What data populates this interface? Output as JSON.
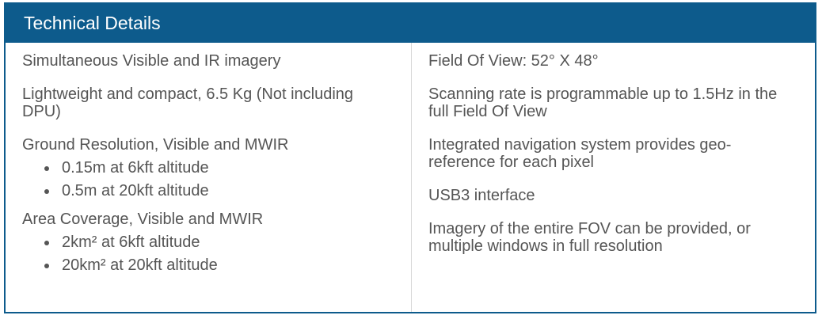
{
  "panel": {
    "title": "Technical Details"
  },
  "left": {
    "items": [
      {
        "text": "Simultaneous Visible and IR imagery"
      },
      {
        "text": "Lightweight and compact, 6.5 Kg (Not including DPU)"
      },
      {
        "text": "Ground Resolution, Visible and MWIR",
        "bullets": [
          "0.15m at 6kft altitude",
          "0.5m at 20kft altitude"
        ]
      },
      {
        "text": "Area Coverage, Visible and MWIR",
        "bullets": [
          "2km² at 6kft altitude",
          "20km² at 20kft altitude"
        ]
      }
    ]
  },
  "right": {
    "items": [
      {
        "text": "Field Of View: 52° X 48°"
      },
      {
        "text": "Scanning rate is programmable up to 1.5Hz in the full Field Of View"
      },
      {
        "text": "Integrated navigation system provides geo-reference for each pixel"
      },
      {
        "text": "USB3 interface"
      },
      {
        "text": "Imagery of the entire FOV can be provided, or multiple windows in full resolution"
      }
    ]
  },
  "colors": {
    "header_bg": "#0d5b8c",
    "header_text": "#ffffff",
    "body_text": "#555555",
    "divider": "#d8d8d8"
  }
}
